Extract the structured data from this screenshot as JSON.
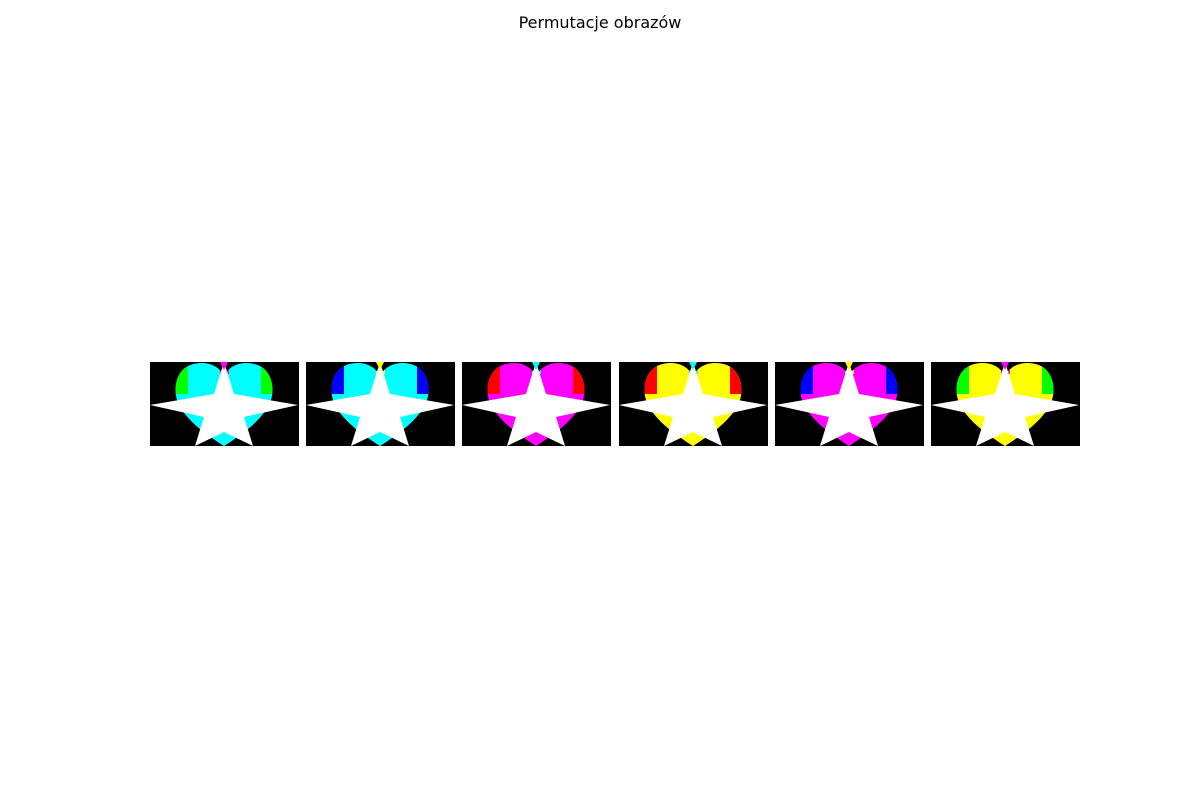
{
  "figure": {
    "title": "Permutacje obrazów"
  },
  "panels": [
    {
      "name": "panel-1",
      "colors": {
        "top": "#00ffff",
        "left": "#00ff00",
        "star_wings": "#0000ff",
        "star_feet": "#ff0000",
        "heart_tip": "#ff00ff",
        "bottom_center": "#00ffff"
      }
    },
    {
      "name": "panel-2",
      "colors": {
        "top": "#00ffff",
        "left": "#0000ff",
        "star_wings": "#00ff00",
        "star_feet": "#ff0000",
        "heart_tip": "#ffff00",
        "bottom_center": "#00ffff"
      }
    },
    {
      "name": "panel-3",
      "colors": {
        "top": "#ff00ff",
        "left": "#ff0000",
        "star_wings": "#0000ff",
        "star_feet": "#00ff00",
        "heart_tip": "#00ffff",
        "bottom_center": "#ff00ff"
      }
    },
    {
      "name": "panel-4",
      "colors": {
        "top": "#ffff00",
        "left": "#ff0000",
        "star_wings": "#00ff00",
        "star_feet": "#0000ff",
        "heart_tip": "#00ffff",
        "bottom_center": "#ffff00"
      }
    },
    {
      "name": "panel-5",
      "colors": {
        "top": "#ff00ff",
        "left": "#0000ff",
        "star_wings": "#ff0000",
        "star_feet": "#00ff00",
        "heart_tip": "#ffff00",
        "bottom_center": "#ff00ff"
      }
    },
    {
      "name": "panel-6",
      "colors": {
        "top": "#ffff00",
        "left": "#00ff00",
        "star_wings": "#ff0000",
        "star_feet": "#0000ff",
        "heart_tip": "#ff00ff",
        "bottom_center": "#ffff00"
      }
    }
  ]
}
